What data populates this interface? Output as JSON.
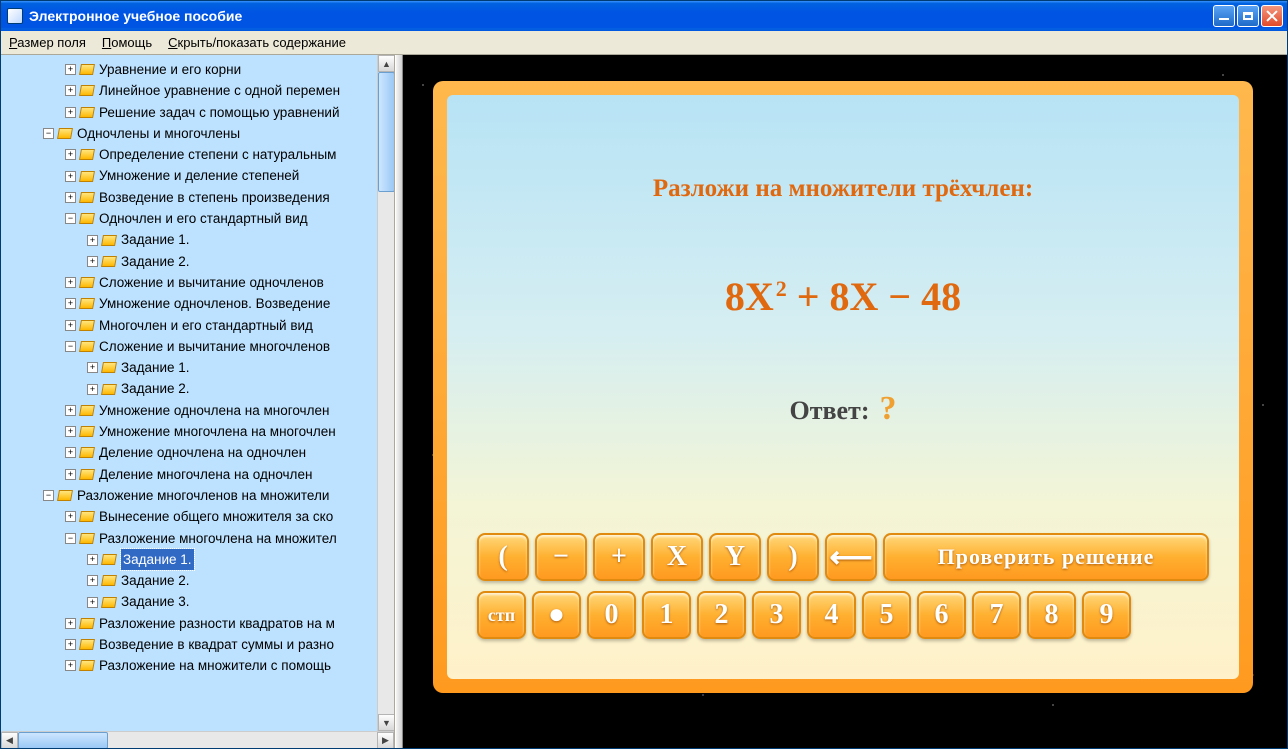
{
  "window": {
    "title": "Электронное учебное пособие"
  },
  "menubar": {
    "size": "Размер поля",
    "help": "Помощь",
    "toggle": "Скрыть/показать содержание"
  },
  "tree": [
    {
      "level": 2,
      "exp": "+",
      "label": "Уравнение и его корни"
    },
    {
      "level": 2,
      "exp": "+",
      "label": "Линейное уравнение с одной перемен"
    },
    {
      "level": 2,
      "exp": "+",
      "label": "Решение задач с помощью уравнений"
    },
    {
      "level": 1,
      "exp": "−",
      "label": "Одночлены и многочлены"
    },
    {
      "level": 2,
      "exp": "+",
      "label": "Определение степени с натуральным"
    },
    {
      "level": 2,
      "exp": "+",
      "label": "Умножение и деление степеней"
    },
    {
      "level": 2,
      "exp": "+",
      "label": "Возведение в степень произведения"
    },
    {
      "level": 2,
      "exp": "−",
      "label": "Одночлен и его стандартный вид"
    },
    {
      "level": 3,
      "exp": "+",
      "label": "Задание 1."
    },
    {
      "level": 3,
      "exp": "+",
      "label": "Задание 2."
    },
    {
      "level": 2,
      "exp": "+",
      "label": "Сложение и вычитание одночленов"
    },
    {
      "level": 2,
      "exp": "+",
      "label": "Умножение одночленов. Возведение"
    },
    {
      "level": 2,
      "exp": "+",
      "label": "Многочлен и его стандартный вид"
    },
    {
      "level": 2,
      "exp": "−",
      "label": "Сложение и вычитание многочленов"
    },
    {
      "level": 3,
      "exp": "+",
      "label": "Задание 1."
    },
    {
      "level": 3,
      "exp": "+",
      "label": "Задание 2."
    },
    {
      "level": 2,
      "exp": "+",
      "label": "Умножение одночлена на многочлен"
    },
    {
      "level": 2,
      "exp": "+",
      "label": "Умножение многочлена на многочлен"
    },
    {
      "level": 2,
      "exp": "+",
      "label": "Деление одночлена на одночлен"
    },
    {
      "level": 2,
      "exp": "+",
      "label": "Деление многочлена на одночлен"
    },
    {
      "level": 1,
      "exp": "−",
      "label": "Разложение многочленов на множители"
    },
    {
      "level": 2,
      "exp": "+",
      "label": "Вынесение общего множителя за ско"
    },
    {
      "level": 2,
      "exp": "−",
      "label": "Разложение многочлена на множител"
    },
    {
      "level": 3,
      "exp": "+",
      "label": "Задание 1.",
      "selected": true
    },
    {
      "level": 3,
      "exp": "+",
      "label": "Задание 2."
    },
    {
      "level": 3,
      "exp": "+",
      "label": "Задание 3."
    },
    {
      "level": 2,
      "exp": "+",
      "label": "Разложение разности квадратов на м"
    },
    {
      "level": 2,
      "exp": "+",
      "label": "Возведение в квадрат суммы и разно"
    },
    {
      "level": 2,
      "exp": "+",
      "label": "Разложение на множители с помощь"
    }
  ],
  "task": {
    "title": "Разложи на множители трёхчлен:",
    "expr_a": "8X",
    "expr_exp": "2",
    "expr_b": " + 8X − 48",
    "answer_label": "Ответ:",
    "answer_placeholder": "?"
  },
  "keys": {
    "row1": [
      "(",
      "−",
      "+",
      "X",
      "Y",
      ")"
    ],
    "back": "←",
    "check": "Проверить решение",
    "stp": "стп",
    "dot": "●",
    "digits": [
      "0",
      "1",
      "2",
      "3",
      "4",
      "5",
      "6",
      "7",
      "8",
      "9"
    ]
  }
}
